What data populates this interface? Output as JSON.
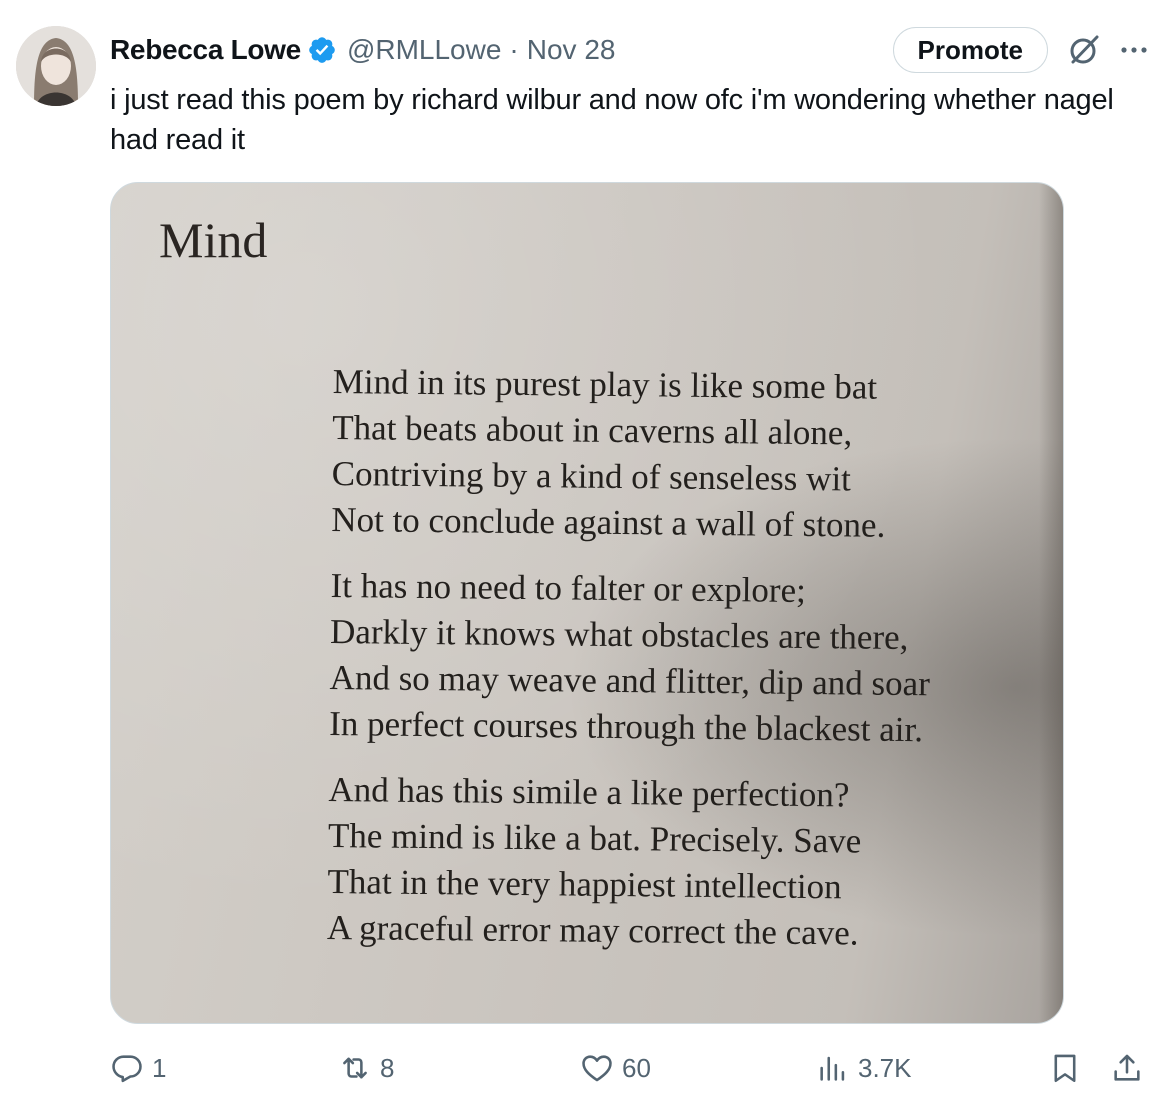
{
  "author": {
    "name": "Rebecca Lowe",
    "handle": "@RMLLowe",
    "separator": "·",
    "date": "Nov 28",
    "verified_color": "#1d9bf0"
  },
  "header_actions": {
    "promote_label": "Promote",
    "grok_icon": "grok-icon",
    "more_icon": "more-icon"
  },
  "tweet": {
    "text": "i just read this poem by richard wilbur and now ofc i'm wondering whether nagel had read it"
  },
  "media": {
    "poem_title": "Mind",
    "stanzas": [
      [
        "Mind in its purest play is like some bat",
        "That beats about in caverns all alone,",
        "Contriving by a kind of senseless wit",
        "Not to conclude against a wall of stone."
      ],
      [
        "It has no need to falter or explore;",
        "Darkly it knows what obstacles are there,",
        "And so may weave and flitter, dip and soar",
        "In perfect courses through the blackest air."
      ],
      [
        "And has this simile a like perfection?",
        "The mind is like a bat. Precisely. Save",
        "That in the very happiest intellection",
        "A graceful error may correct the cave."
      ]
    ]
  },
  "actions": {
    "replies": "1",
    "reposts": "8",
    "likes": "60",
    "views": "3.7K"
  },
  "colors": {
    "text_primary": "#0f1419",
    "text_secondary": "#536471",
    "border": "#cfd9de"
  }
}
